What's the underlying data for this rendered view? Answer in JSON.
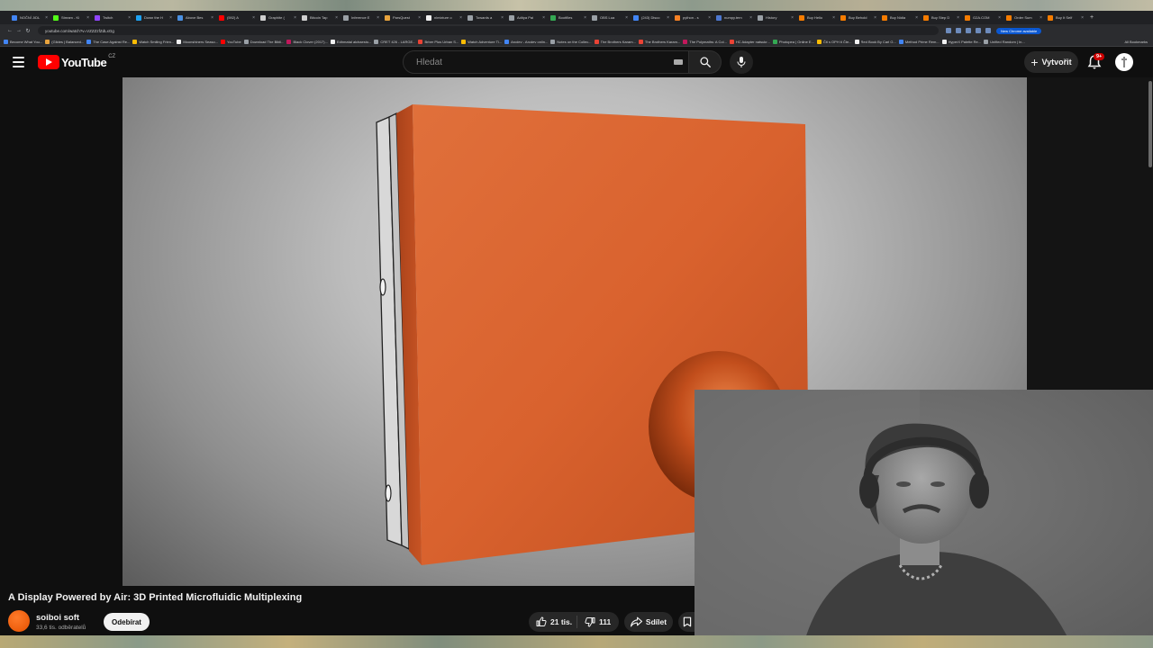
{
  "browser": {
    "tabs": [
      {
        "label": "NOČNÍ JíDL",
        "color": "#4285f4"
      },
      {
        "label": "Stream - Ki",
        "color": "#53fc18"
      },
      {
        "label": "Twitch",
        "color": "#9146ff"
      },
      {
        "label": "Down the H",
        "color": "#1da1f2"
      },
      {
        "label": "Above Bes",
        "color": "#4a90e2"
      },
      {
        "label": "(592) A",
        "color": "#ff0000"
      },
      {
        "label": "Graphite (",
        "color": "#cfcfcf"
      },
      {
        "label": "Bitcoin Tap",
        "color": "#cfcfcf"
      },
      {
        "label": "Inference E",
        "color": "#9aa0a6"
      },
      {
        "label": "ParsQuest",
        "color": "#e8a33d"
      },
      {
        "label": "nlmixture o",
        "color": "#f1f1f1"
      },
      {
        "label": "Towards a",
        "color": "#9aa0a6"
      },
      {
        "label": "Aditya Pai",
        "color": "#9aa0a6"
      },
      {
        "label": "Bootfiles",
        "color": "#34a853"
      },
      {
        "label": "OBS Lua",
        "color": "#9aa0a6"
      },
      {
        "label": "(243) Disco",
        "color": "#4285f4"
      },
      {
        "label": "python - s",
        "color": "#f48024"
      },
      {
        "label": "numpy.tern",
        "color": "#4d77cf"
      },
      {
        "label": "History",
        "color": "#9aa0a6"
      },
      {
        "label": "Buy Helio",
        "color": "#f57c00"
      },
      {
        "label": "Buy Behold",
        "color": "#f57c00"
      },
      {
        "label": "Buy Nidia",
        "color": "#f57c00"
      },
      {
        "label": "Buy Step D",
        "color": "#f57c00"
      },
      {
        "label": "G2A.COM",
        "color": "#f57c00"
      },
      {
        "label": "Order Sum",
        "color": "#f57c00"
      },
      {
        "label": "Buy It Self",
        "color": "#f57c00"
      }
    ],
    "url": "youtube.com/watch?v=VZZZzfZdLxGg",
    "new_chrome": "New Chrome available",
    "bookmarks": [
      {
        "label": "Become What You...",
        "color": "#4285f4"
      },
      {
        "label": "(Glides | Balanced...",
        "color": "#e8a33d"
      },
      {
        "label": "The Case Against Re...",
        "color": "#4285f4"
      },
      {
        "label": "Watch Smiling Frien...",
        "color": "#fbbc04"
      },
      {
        "label": "Moonshiners Seaso...",
        "color": "#f1f1f1"
      },
      {
        "label": "YouTube",
        "color": "#ff0000"
      },
      {
        "label": "Download The Bibli...",
        "color": "#9aa0a6"
      },
      {
        "label": "Black Clover (2017)...",
        "color": "#c2185b"
      },
      {
        "label": "Edhmatal alchaesto...",
        "color": "#f1f1f1"
      },
      {
        "label": "CRET 426 - LARGE...",
        "color": "#9aa0a6"
      },
      {
        "label": "Brber Plus Urban S...",
        "color": "#ea4335"
      },
      {
        "label": "Watch Adventure Ti...",
        "color": "#fbbc04"
      },
      {
        "label": "Arcdev - Arcdev onlin...",
        "color": "#4285f4"
      },
      {
        "label": "Notes on the Collec...",
        "color": "#9aa0a6"
      },
      {
        "label": "The Brothers Karam...",
        "color": "#ea4335"
      },
      {
        "label": "The Brothers Karam...",
        "color": "#ea4335"
      },
      {
        "label": "The Polymaths: A Col...",
        "color": "#c2185b"
      },
      {
        "label": "HC Adapter natsukr...",
        "color": "#ea4335"
      },
      {
        "label": "Photopea | Online E...",
        "color": "#34a853"
      },
      {
        "label": "Čti s OPH ti Čte...",
        "color": "#fbbc04"
      },
      {
        "label": "Red Book By Carl G...",
        "color": "#f1f1f1"
      },
      {
        "label": "Method Prime Rem...",
        "color": "#4285f4"
      },
      {
        "label": "HyperX Palette Re...",
        "color": "#f1f1f1"
      },
      {
        "label": "Unified Random | In...",
        "color": "#9aa0a6"
      }
    ],
    "all_bookmarks": "All Bookmarks"
  },
  "header": {
    "logo_text": "YouTube",
    "country": "CZ",
    "search_placeholder": "Hledat",
    "create_label": "Vytvořit",
    "notification_count": "9+"
  },
  "video": {
    "title": "A Display Powered by Air: 3D Printed Microfluidic Multiplexing",
    "channel_name": "soiboi soft",
    "subscribers": "33,6 tis. odběratelů",
    "subscribe_label": "Odebírat",
    "likes": "21 tis.",
    "dislikes": "111",
    "share_label": "Sdílet"
  },
  "colors": {
    "accent": "#ff0000",
    "model_orange": "#d9602c",
    "background": "#0f0f0f"
  }
}
